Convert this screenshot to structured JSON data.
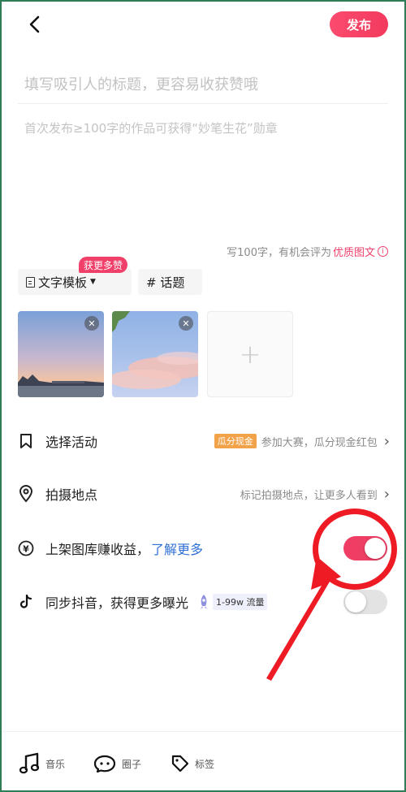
{
  "header": {
    "publish_label": "发布"
  },
  "editor": {
    "title_placeholder": "填写吸引人的标题，更容易收获赞哦",
    "body_placeholder": "首次发布≥100字的作品可获得“妙笔生花”勋章",
    "hint_text": "写100字，有机会评为",
    "hint_highlight": "优质图文"
  },
  "chips": {
    "template_label": "文字模板",
    "template_badge": "获更多赞",
    "topic_label": "# 话题"
  },
  "media": {
    "remove_symbol": "✕",
    "add_symbol": "+"
  },
  "options": {
    "activity": {
      "label": "选择活动",
      "tag": "瓜分现金",
      "desc": "参加大赛，瓜分现金红包"
    },
    "location": {
      "label": "拍摄地点",
      "desc": "标记拍摄地点，让更多人看到"
    },
    "gallery": {
      "label": "上架图库赚收益，",
      "link": "了解更多",
      "toggle_on": true
    },
    "douyin": {
      "label": "同步抖音，获得更多曝光",
      "traffic": "1-99w 流量",
      "toggle_on": false
    }
  },
  "bottom_bar": {
    "music": "音乐",
    "circle": "圈子",
    "tags": "标签"
  },
  "colors": {
    "accent": "#ee3e64",
    "annotation": "#ee1b24",
    "link": "#2f6fd6",
    "tag_cash": "#f2a34a"
  }
}
